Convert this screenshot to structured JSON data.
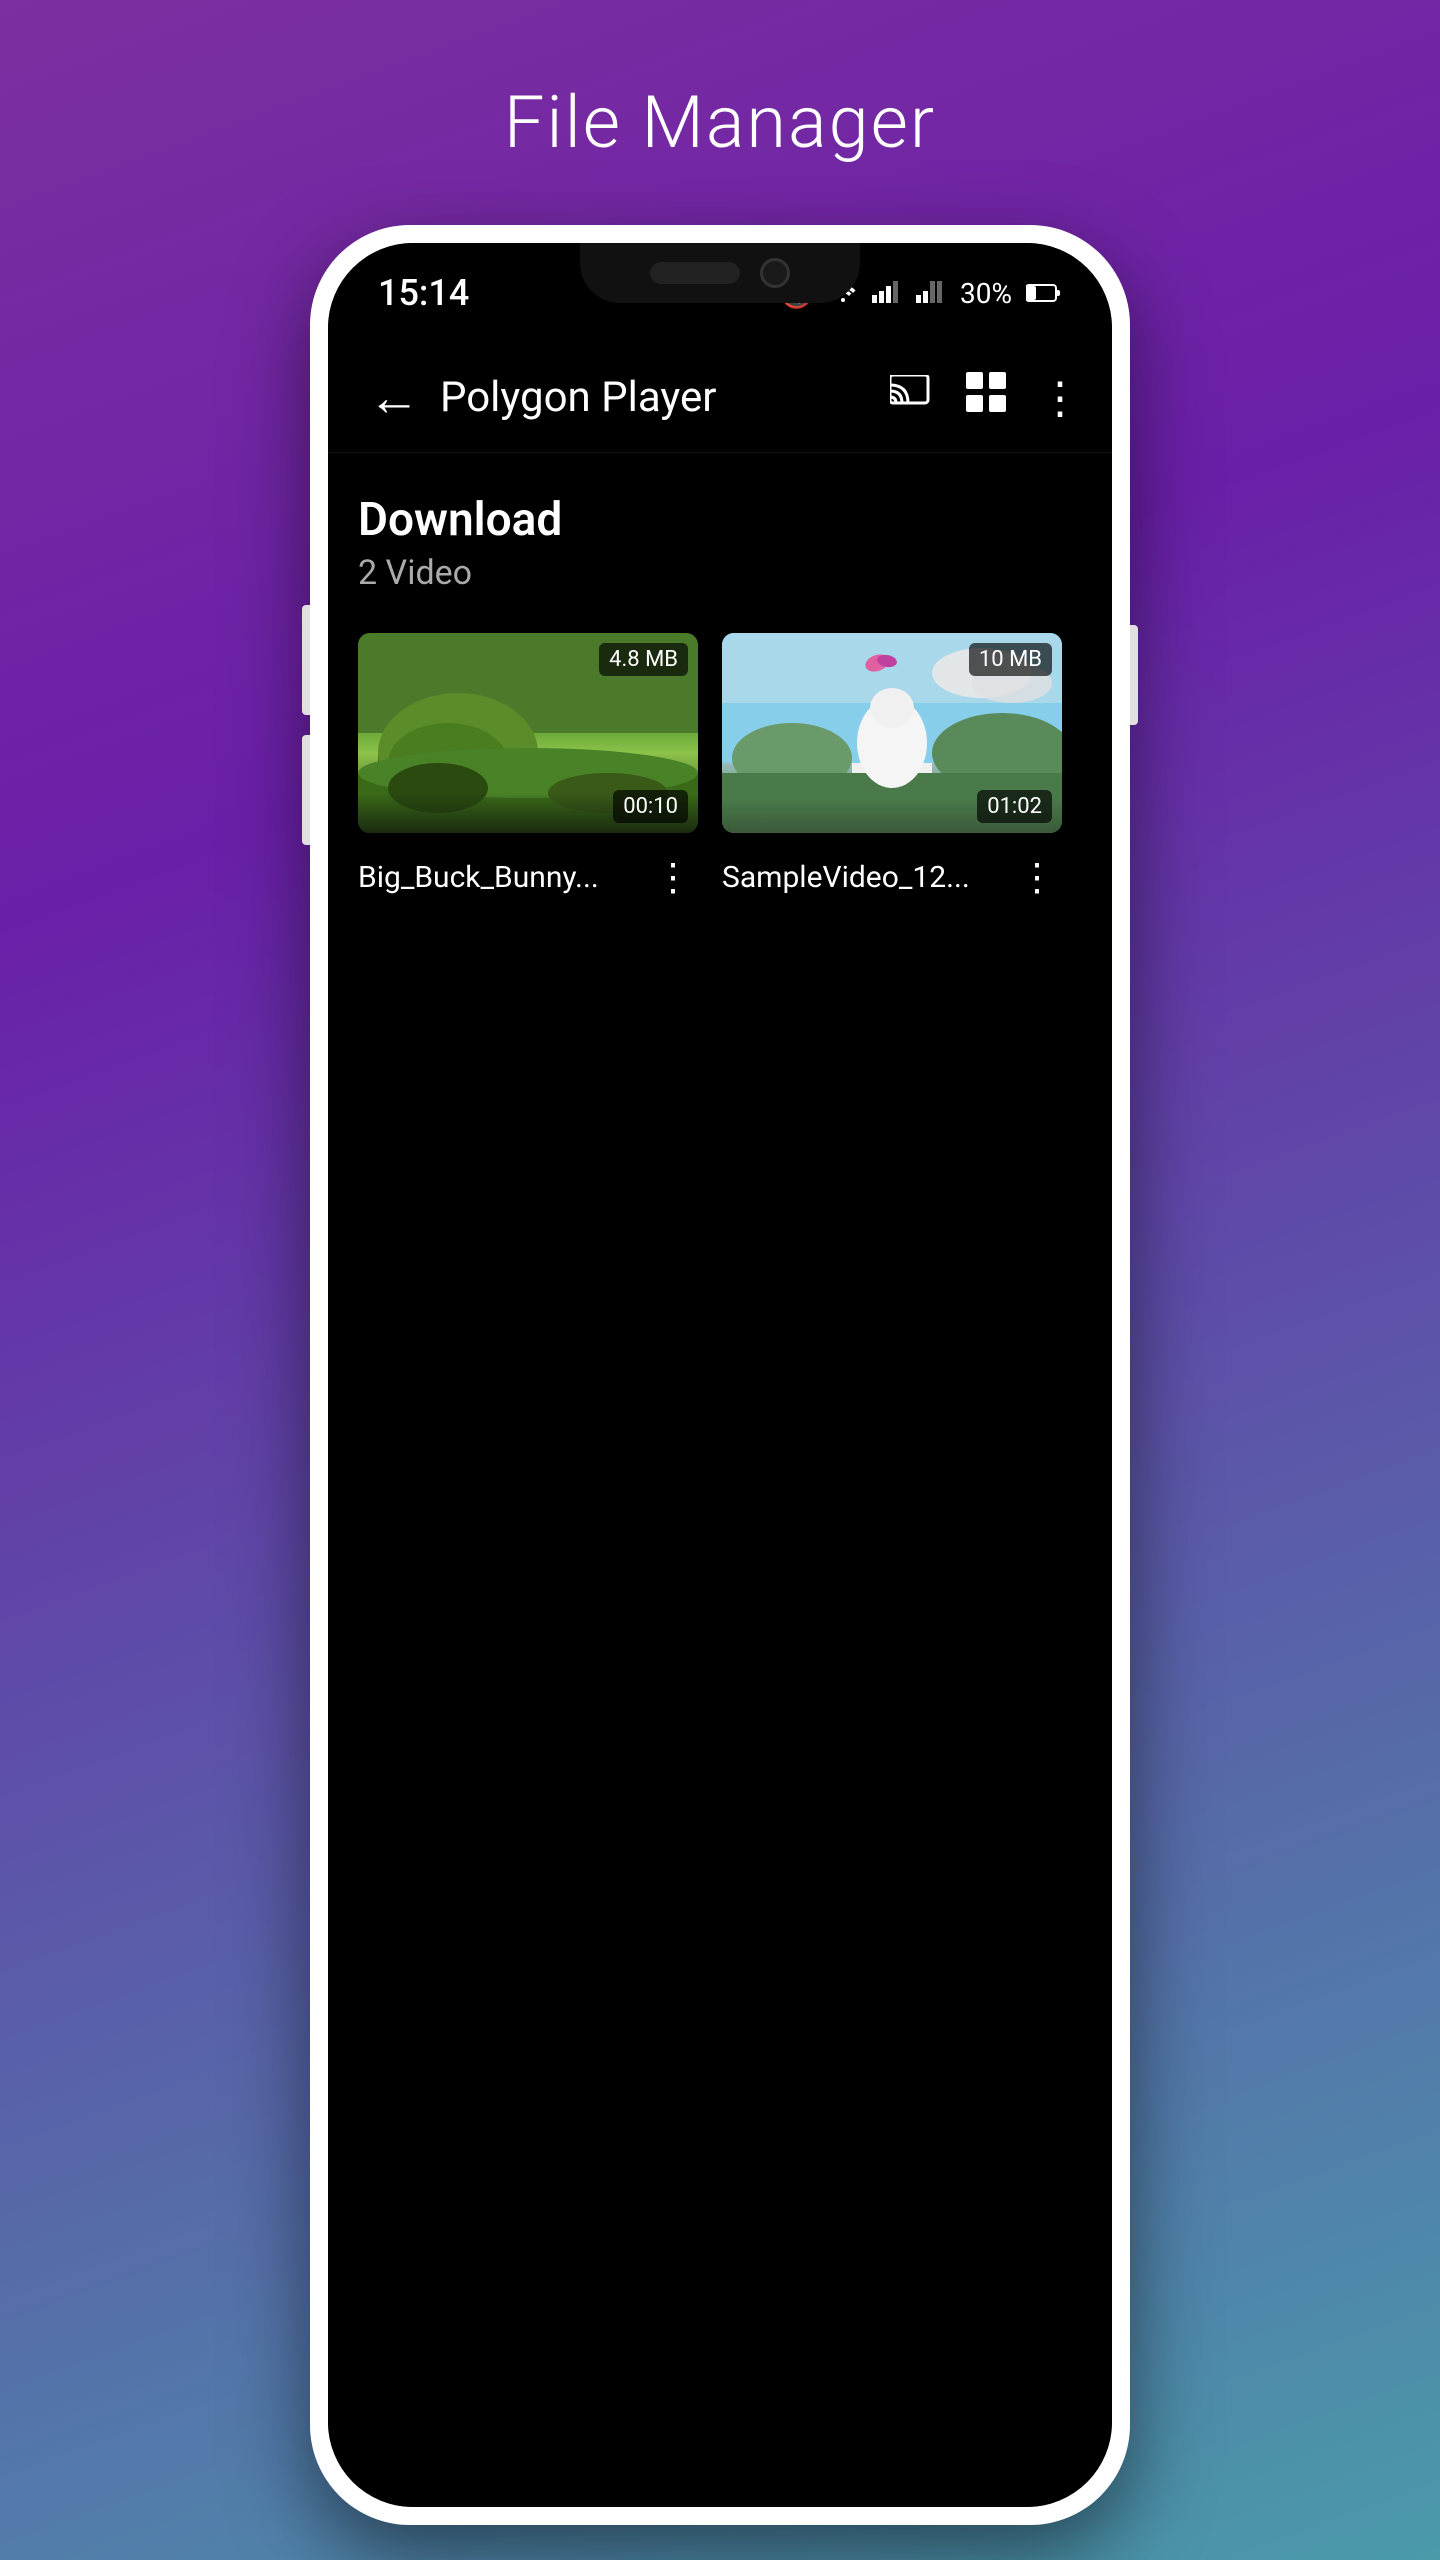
{
  "page": {
    "title": "File Manager",
    "background_top_color": "#7b2fa0",
    "background_bottom_color": "#4a9aaa"
  },
  "status_bar": {
    "time": "15:14",
    "battery": "30%",
    "mute_icon": "🔇",
    "wifi_icon": "wifi",
    "signal_icon": "signal"
  },
  "app_bar": {
    "title": "Polygon Player",
    "back_label": "←",
    "cast_label": "cast",
    "grid_label": "grid",
    "more_label": "⋮"
  },
  "folder": {
    "name": "Download",
    "subtitle": "2 Video"
  },
  "videos": [
    {
      "id": "video-1",
      "name": "Big_Buck_Bunny...",
      "size": "4.8 MB",
      "duration": "00:10",
      "thumb_type": "bbb"
    },
    {
      "id": "video-2",
      "name": "SampleVideo_12...",
      "size": "10 MB",
      "duration": "01:02",
      "thumb_type": "sv"
    }
  ]
}
